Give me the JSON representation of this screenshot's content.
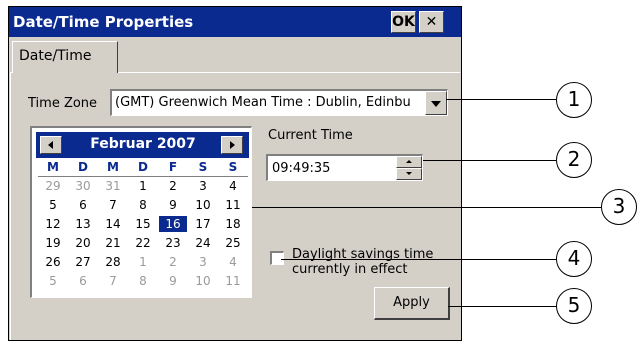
{
  "window": {
    "title": "Date/Time Properties",
    "ok_label": "OK",
    "close_label": "✕"
  },
  "tabs": [
    {
      "label": "Date/Time"
    }
  ],
  "time_zone": {
    "label": "Time Zone",
    "value": "(GMT) Greenwich Mean Time : Dublin, Edinbu"
  },
  "calendar": {
    "month_label": "Februar 2007",
    "weekday_headers": [
      "M",
      "D",
      "M",
      "D",
      "F",
      "S",
      "S"
    ],
    "weeks": [
      [
        "29",
        "30",
        "31",
        "1",
        "2",
        "3",
        "4"
      ],
      [
        "5",
        "6",
        "7",
        "8",
        "9",
        "10",
        "11"
      ],
      [
        "12",
        "13",
        "14",
        "15",
        "16",
        "17",
        "18"
      ],
      [
        "19",
        "20",
        "21",
        "22",
        "23",
        "24",
        "25"
      ],
      [
        "26",
        "27",
        "28",
        "1",
        "2",
        "3",
        "4"
      ],
      [
        "5",
        "6",
        "7",
        "8",
        "9",
        "10",
        "11"
      ]
    ],
    "selected_day": "16"
  },
  "current_time": {
    "label": "Current Time",
    "value": "09:49:35"
  },
  "daylight": {
    "label_line1": "Daylight savings time",
    "label_line2": "currently in effect",
    "checked": false
  },
  "apply_button": {
    "label": "Apply"
  },
  "callouts": [
    "1",
    "2",
    "3",
    "4",
    "5"
  ],
  "colors": {
    "title_bar": "#0a2a8f",
    "dialog_bg": "#d4d0c8",
    "selected_day_bg": "#0a2a8f"
  }
}
